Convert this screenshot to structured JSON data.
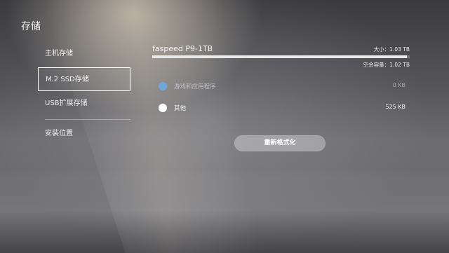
{
  "page": {
    "title": "存储"
  },
  "sidebar": {
    "items": [
      {
        "label": "主机存储"
      },
      {
        "label": "M.2 SSD存储"
      },
      {
        "label": "USB扩展存储"
      },
      {
        "label": "安装位置"
      }
    ],
    "selected_index": 1
  },
  "drive": {
    "name": "faspeed P9-1TB",
    "size_text": "大小：1.03 TB",
    "free_text": "空余容量：1.02 TB",
    "used_fraction": 0.99
  },
  "usage_rows": [
    {
      "label": "游戏和应用程序",
      "value": "0 KB",
      "color": "#6fa8dc"
    },
    {
      "label": "其他",
      "value": "525 KB",
      "color": "#ffffff"
    }
  ],
  "actions": {
    "reformat_label": "重新格式化"
  }
}
